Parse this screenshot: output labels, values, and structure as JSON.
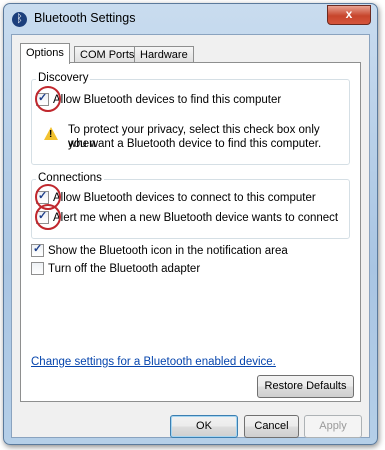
{
  "window": {
    "title": "Bluetooth Settings",
    "close_glyph": "x",
    "app_icon": "bluetooth-icon"
  },
  "tabs": [
    {
      "label": "Options",
      "active": true
    },
    {
      "label": "COM Ports",
      "active": false
    },
    {
      "label": "Hardware",
      "active": false
    }
  ],
  "discovery": {
    "label": "Discovery",
    "allow_find": {
      "label": "Allow Bluetooth devices to find this computer",
      "checked": true
    },
    "warning_line1": "To protect your privacy, select this check box only when",
    "warning_line2": "you want a Bluetooth device to find this computer.",
    "warning_glyph": "!"
  },
  "connections": {
    "label": "Connections",
    "allow_connect": {
      "label": "Allow Bluetooth devices to connect to this computer",
      "checked": true
    },
    "alert_new": {
      "label": "Alert me when a new Bluetooth device wants to connect",
      "checked": true
    }
  },
  "show_icon": {
    "label": "Show the Bluetooth icon in the notification area",
    "checked": true
  },
  "turn_off": {
    "label": "Turn off the Bluetooth adapter",
    "checked": false
  },
  "link": "Change settings for a Bluetooth enabled device.",
  "buttons": {
    "restore": "Restore Defaults",
    "ok": "OK",
    "cancel": "Cancel",
    "apply": "Apply"
  },
  "colors": {
    "annotation_circle": "#c0272d",
    "link": "#0645ad",
    "warning": "#f2c230"
  }
}
